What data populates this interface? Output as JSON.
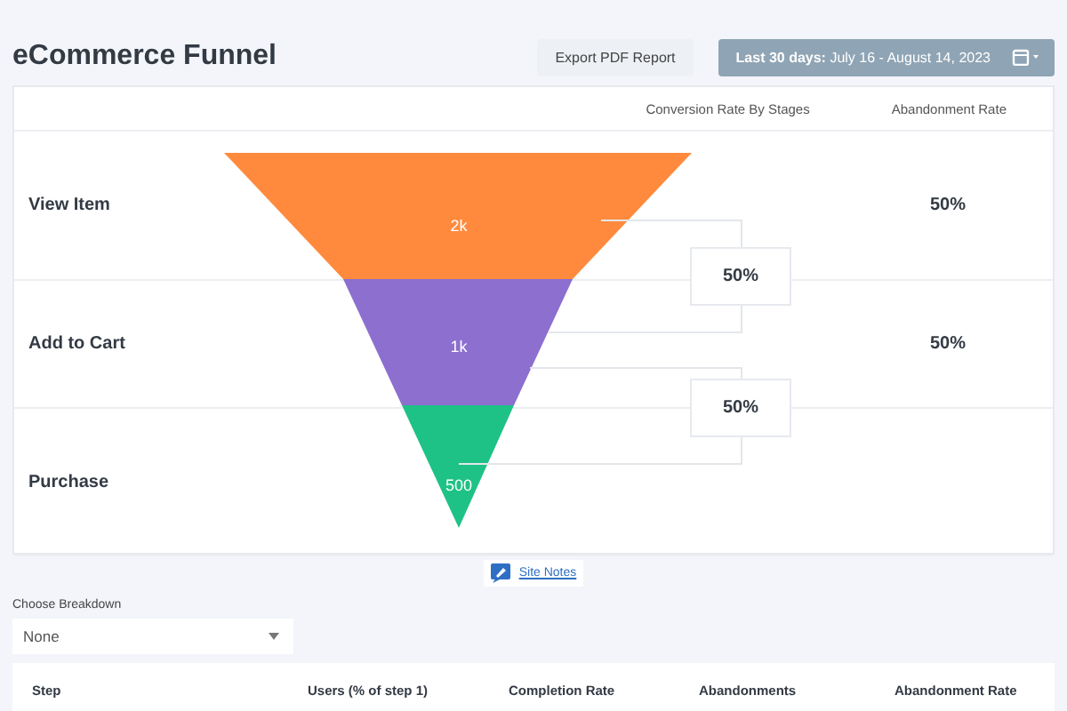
{
  "title": "eCommerce Funnel",
  "export_button": "Export PDF Report",
  "date_range": "**Last 30 days:** July 16 - August 14, 2023",
  "funnel": {
    "columns": [
      "Conversion Rate By Stages",
      "Abandonment Rate"
    ],
    "stages": [
      {
        "name": "View Item",
        "value": "2k",
        "color": "#ff8a3d",
        "abandonment_rate": "50%"
      },
      {
        "name": "Add to Cart",
        "value": "1k",
        "color": "#8c6fcf",
        "abandonment_rate": "50%"
      },
      {
        "name": "Purchase",
        "value": "500",
        "color": "#1ec286"
      }
    ],
    "conversion_rates": [
      "50%",
      "50%"
    ]
  },
  "site_notes": "Site Notes",
  "breakdown": {
    "label": "Choose Breakdown",
    "value": "None"
  },
  "table": {
    "columns": [
      "Step",
      "Users (% of step 1)",
      "Completion Rate",
      "Abandonments",
      "Abandonment Rate"
    ]
  }
}
